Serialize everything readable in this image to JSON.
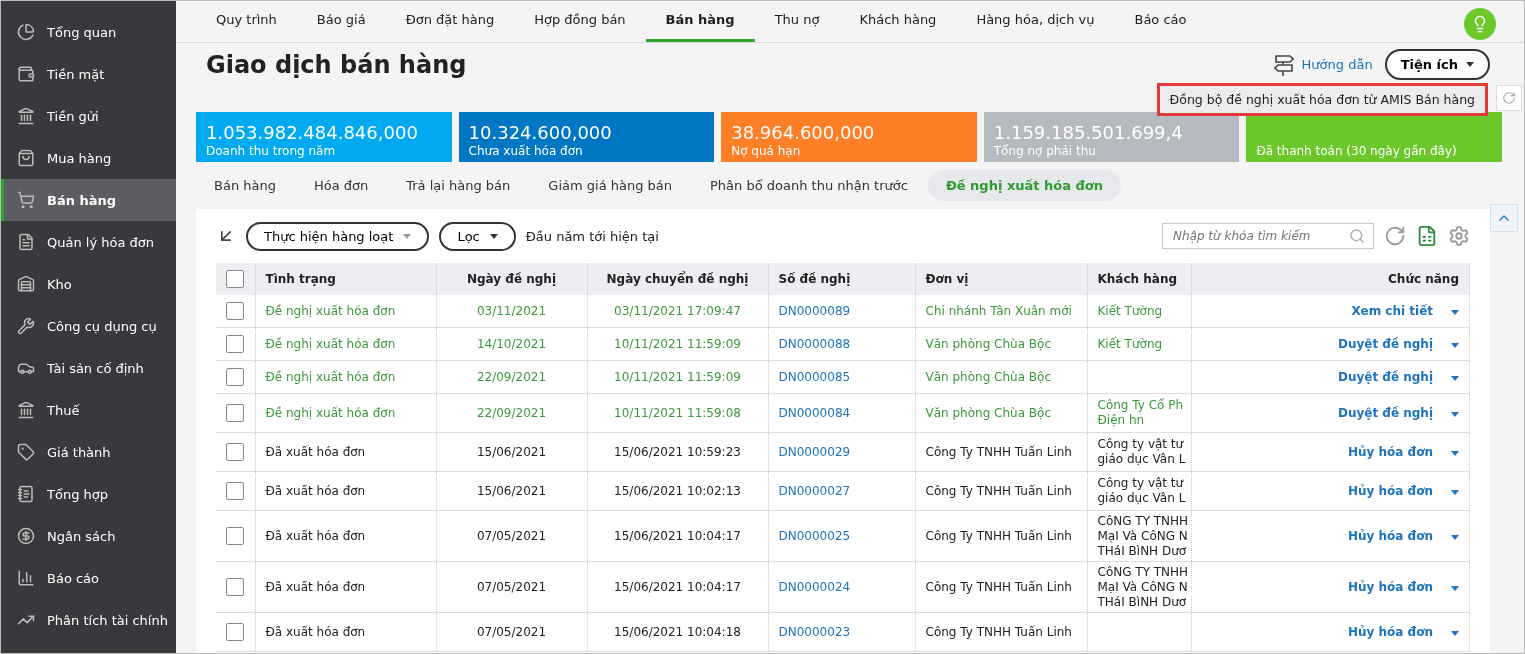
{
  "sidebar": {
    "items": [
      {
        "label": "Tổng quan",
        "selected": false
      },
      {
        "label": "Tiền mặt",
        "selected": false
      },
      {
        "label": "Tiền gửi",
        "selected": false
      },
      {
        "label": "Mua hàng",
        "selected": false
      },
      {
        "label": "Bán hàng",
        "selected": true
      },
      {
        "label": "Quản lý hóa đơn",
        "selected": false
      },
      {
        "label": "Kho",
        "selected": false
      },
      {
        "label": "Công cụ dụng cụ",
        "selected": false
      },
      {
        "label": "Tài sản cố định",
        "selected": false
      },
      {
        "label": "Thuế",
        "selected": false
      },
      {
        "label": "Giá thành",
        "selected": false
      },
      {
        "label": "Tổng hợp",
        "selected": false
      },
      {
        "label": "Ngân sách",
        "selected": false
      },
      {
        "label": "Báo cáo",
        "selected": false
      },
      {
        "label": "Phân tích tài chính",
        "selected": false
      }
    ]
  },
  "top_tabs": [
    {
      "label": "Quy trình",
      "selected": false
    },
    {
      "label": "Báo giá",
      "selected": false
    },
    {
      "label": "Đơn đặt hàng",
      "selected": false
    },
    {
      "label": "Hợp đồng bán",
      "selected": false
    },
    {
      "label": "Bán hàng",
      "selected": true
    },
    {
      "label": "Thu nợ",
      "selected": false
    },
    {
      "label": "Khách hàng",
      "selected": false
    },
    {
      "label": "Hàng hóa, dịch vụ",
      "selected": false
    },
    {
      "label": "Báo cáo",
      "selected": false
    }
  ],
  "page_title": "Giao dịch bán hàng",
  "guide_link": "Hướng dẫn",
  "utilities_button": "Tiện ích",
  "utilities_menu": [
    "Đồng bộ đề nghị xuất hóa đơn từ AMIS Bán hàng"
  ],
  "kpi_cards": [
    {
      "value": "1.053.982.484.846,000",
      "label": "Doanh thu trong năm",
      "color": "#00a9f0"
    },
    {
      "value": "10.324.600,000",
      "label": "Chưa xuất hóa đơn",
      "color": "#0077c2"
    },
    {
      "value": "38.964.600,000",
      "label": "Nợ quá hạn",
      "color": "#ff7f27"
    },
    {
      "value": "1.159.185.501.699,4",
      "label": "Tổng nợ phải thu",
      "color": "#b6b9bf"
    },
    {
      "label": "Đã thanh toán (30 ngày gần đây)",
      "color": "#6cc72a"
    }
  ],
  "sub_tabs": [
    {
      "label": "Bán hàng",
      "selected": false
    },
    {
      "label": "Hóa đơn",
      "selected": false
    },
    {
      "label": "Trả lại hàng bán",
      "selected": false
    },
    {
      "label": "Giảm giá hàng bán",
      "selected": false
    },
    {
      "label": "Phân bổ doanh thu nhận trước",
      "selected": false
    },
    {
      "label": "Đề nghị xuất hóa đơn",
      "selected": true
    }
  ],
  "toolbar": {
    "batch_button": "Thực hiện hàng loạt",
    "filter_button": "Lọc",
    "period": "Đầu năm tới hiện tại",
    "search": {
      "placeholder": "Nhập từ khóa tìm kiếm"
    }
  },
  "table": {
    "select_all": {
      "checked": false
    },
    "columns": [
      "Tình trạng",
      "Ngày đề nghị",
      "Ngày chuyển đề nghị",
      "Số đề nghị",
      "Đơn vị",
      "Khách hàng",
      "Chức năng"
    ],
    "rows": [
      {
        "kind": "pending",
        "checked": false,
        "status": "Đề nghị xuất hóa đơn",
        "date": "03/11/2021",
        "sent": "03/11/2021 17:09:47",
        "number": "DN0000089",
        "unit": "Chi nhánh Tân Xuân mới",
        "customer": [
          "Kiết Tường"
        ],
        "action": "Xem chi tiết"
      },
      {
        "kind": "pending",
        "checked": false,
        "status": "Đề nghị xuất hóa đơn",
        "date": "14/10/2021",
        "sent": "10/11/2021 11:59:09",
        "number": "DN0000088",
        "unit": "Văn phòng Chùa Bộc",
        "customer": [
          "Kiết Tường"
        ],
        "action": "Duyệt đề nghị"
      },
      {
        "kind": "pending",
        "checked": false,
        "status": "Đề nghị xuất hóa đơn",
        "date": "22/09/2021",
        "sent": "10/11/2021 11:59:09",
        "number": "DN0000085",
        "unit": "Văn phòng Chùa Bộc",
        "customer": [],
        "action": "Duyệt đề nghị"
      },
      {
        "kind": "pending",
        "checked": false,
        "status": "Đề nghị xuất hóa đơn",
        "date": "22/09/2021",
        "sent": "10/11/2021 11:59:08",
        "number": "DN0000084",
        "unit": "Văn phòng Chùa Bộc",
        "customer": [
          "Công Ty Cổ Ph",
          "Điện hn"
        ],
        "action": "Duyệt đề nghị"
      },
      {
        "kind": "issued",
        "checked": false,
        "status": "Đã xuất hóa đơn",
        "date": "15/06/2021",
        "sent": "15/06/2021 10:59:23",
        "number": "DN0000029",
        "unit": "Công Ty TNHH Tuấn Linh",
        "customer": [
          "Công ty vật tư",
          "giáo dục Vân L"
        ],
        "action": "Hủy hóa đơn"
      },
      {
        "kind": "issued",
        "checked": false,
        "status": "Đã xuất hóa đơn",
        "date": "15/06/2021",
        "sent": "15/06/2021 10:02:13",
        "number": "DN0000027",
        "unit": "Công Ty TNHH Tuấn Linh",
        "customer": [
          "Công ty vật tư",
          "giáo dục Vân L"
        ],
        "action": "Hủy hóa đơn"
      },
      {
        "kind": "issued",
        "checked": false,
        "status": "Đã xuất hóa đơn",
        "date": "07/05/2021",
        "sent": "15/06/2021 10:04:17",
        "number": "DN0000025",
        "unit": "Công Ty TNHH Tuấn Linh",
        "customer": [
          "CôNG TY TNHH",
          "MạI Và CôNG N",
          "THáI BìNH Dươ"
        ],
        "action": "Hủy hóa đơn"
      },
      {
        "kind": "issued",
        "checked": false,
        "status": "Đã xuất hóa đơn",
        "date": "07/05/2021",
        "sent": "15/06/2021 10:04:17",
        "number": "DN0000024",
        "unit": "Công Ty TNHH Tuấn Linh",
        "customer": [
          "CôNG TY TNHH",
          "MạI Và CôNG N",
          "THáI BìNH Dươ"
        ],
        "action": "Hủy hóa đơn"
      },
      {
        "kind": "issued",
        "checked": false,
        "status": "Đã xuất hóa đơn",
        "date": "07/05/2021",
        "sent": "15/06/2021 10:04:18",
        "number": "DN0000023",
        "unit": "Công Ty TNHH Tuấn Linh",
        "customer": [],
        "action": "Hủy hóa đơn"
      }
    ]
  }
}
